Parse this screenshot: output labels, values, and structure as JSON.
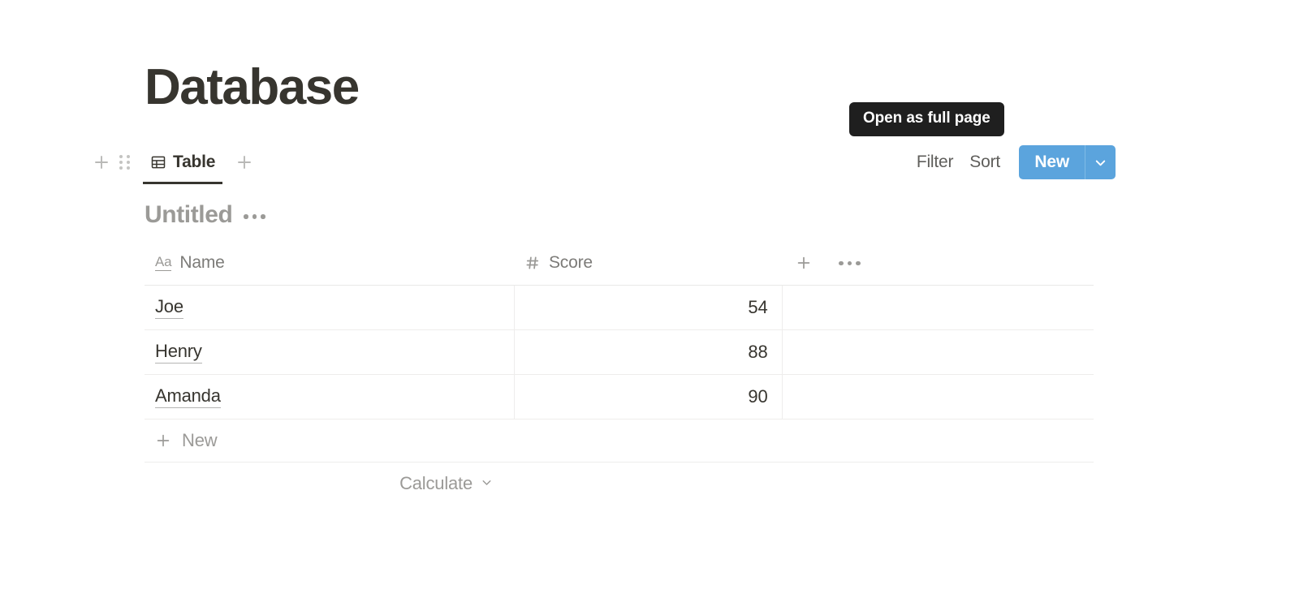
{
  "page": {
    "title": "Database"
  },
  "view_bar": {
    "add_view_left_icon": "plus-icon",
    "drag_handle_icon": "grip-dots-icon",
    "tabs": [
      {
        "label": "Table",
        "icon": "table-icon",
        "active": true
      }
    ],
    "add_tab_icon": "plus-icon",
    "tools": {
      "filter_label": "Filter",
      "sort_label": "Sort",
      "search_icon": "search-icon",
      "expand_icon": "expand-diagonal-icon",
      "more_icon": "ellipsis-icon",
      "new_label": "New",
      "new_caret_icon": "chevron-down-icon"
    }
  },
  "tooltip": {
    "text": "Open as full page"
  },
  "database": {
    "title": "Untitled",
    "title_menu_icon": "ellipsis-icon",
    "columns": [
      {
        "label": "Name",
        "type_icon": "text-type-icon",
        "type_glyph": "Aa"
      },
      {
        "label": "Score",
        "type_icon": "number-type-icon",
        "type_glyph": "#"
      }
    ],
    "header_actions": {
      "add_column_icon": "plus-icon",
      "more_icon": "ellipsis-icon"
    },
    "rows": [
      {
        "name": "Joe",
        "score": "54"
      },
      {
        "name": "Henry",
        "score": "88"
      },
      {
        "name": "Amanda",
        "score": "90"
      }
    ],
    "new_row_label": "New",
    "new_row_icon": "plus-icon",
    "calculate_label": "Calculate",
    "calculate_caret_icon": "chevron-down-icon"
  },
  "colors": {
    "accent_blue": "#5ba4dd",
    "tooltip_bg": "#1f1f1f",
    "text_primary": "#37352f",
    "text_muted": "#9b9a97",
    "border": "#eeedec"
  }
}
